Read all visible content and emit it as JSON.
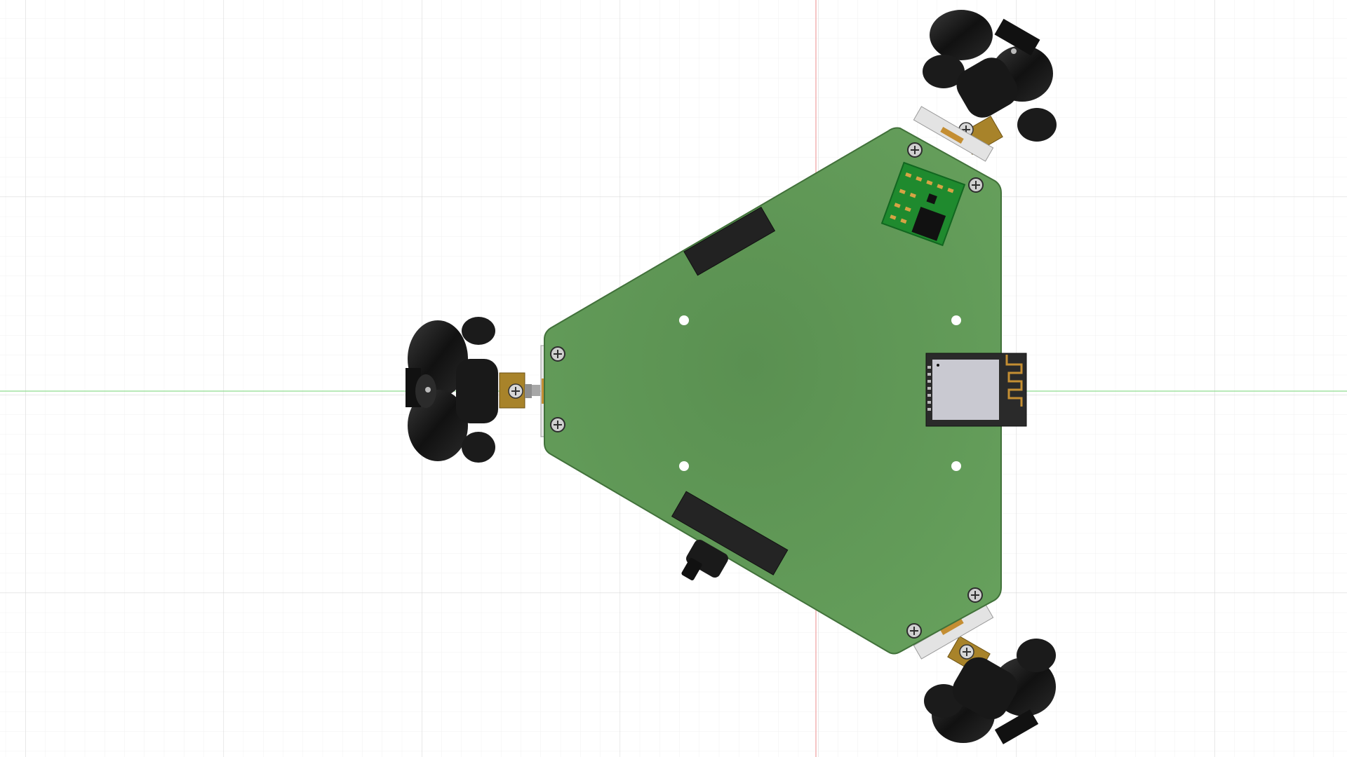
{
  "app": {
    "view": "top-view",
    "background_color": "#ffffff",
    "grid": {
      "minor_color": "#f1f1f1",
      "major_color": "#dcdcdc",
      "x_axis_color": "#8fdc8f",
      "y_axis_color": "#f0a0a0"
    }
  },
  "model": {
    "board_color": "#5d9455",
    "board_edge_color": "#3f6e39",
    "module_color": "#c9c9d1",
    "wheel_color": "#141414",
    "hub_color": "#b08a2e",
    "icons": {
      "wifi_antenna": "antenna-trace-icon",
      "screw": "screw-icon"
    }
  }
}
